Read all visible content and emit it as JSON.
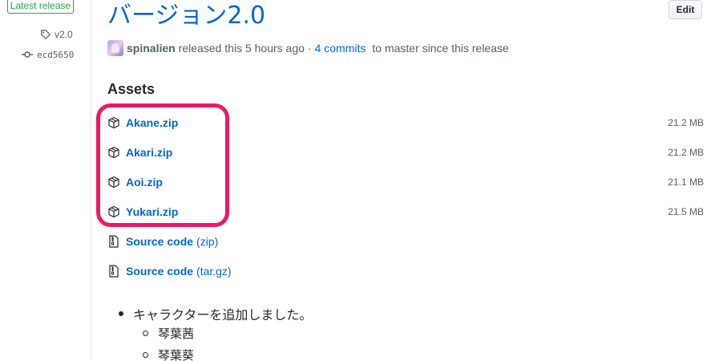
{
  "sidebar": {
    "latest_badge": "Latest release",
    "tag": "v2.0",
    "commit": "ecd5650"
  },
  "header": {
    "title": "バージョン2.0",
    "edit_label": "Edit",
    "meta": {
      "user": "spinalien",
      "released_text": "released this 5 hours ago",
      "separator": "·",
      "commits_link": "4 commits",
      "commits_suffix": "to master since this release"
    }
  },
  "assets": {
    "title": "Assets",
    "files": [
      {
        "name": "Akane.zip",
        "size": "21.2 MB",
        "icon": "package-icon"
      },
      {
        "name": "Akari.zip",
        "size": "21.2 MB",
        "icon": "package-icon"
      },
      {
        "name": "Aoi.zip",
        "size": "21.1 MB",
        "icon": "package-icon"
      },
      {
        "name": "Yukari.zip",
        "size": "21.5 MB",
        "icon": "package-icon"
      }
    ],
    "source": [
      {
        "name": "Source code",
        "kind": "(zip)",
        "icon": "file-zip-icon"
      },
      {
        "name": "Source code",
        "kind": "(tar.gz)",
        "icon": "file-zip-icon"
      }
    ]
  },
  "notes": {
    "items": [
      {
        "text": "キャラクターを追加しました。",
        "children": [
          "琴葉茜",
          "琴葉葵"
        ]
      }
    ]
  },
  "colors": {
    "link": "#0366d6",
    "highlight": "#ea1a66",
    "badge_green": "#28a745"
  }
}
